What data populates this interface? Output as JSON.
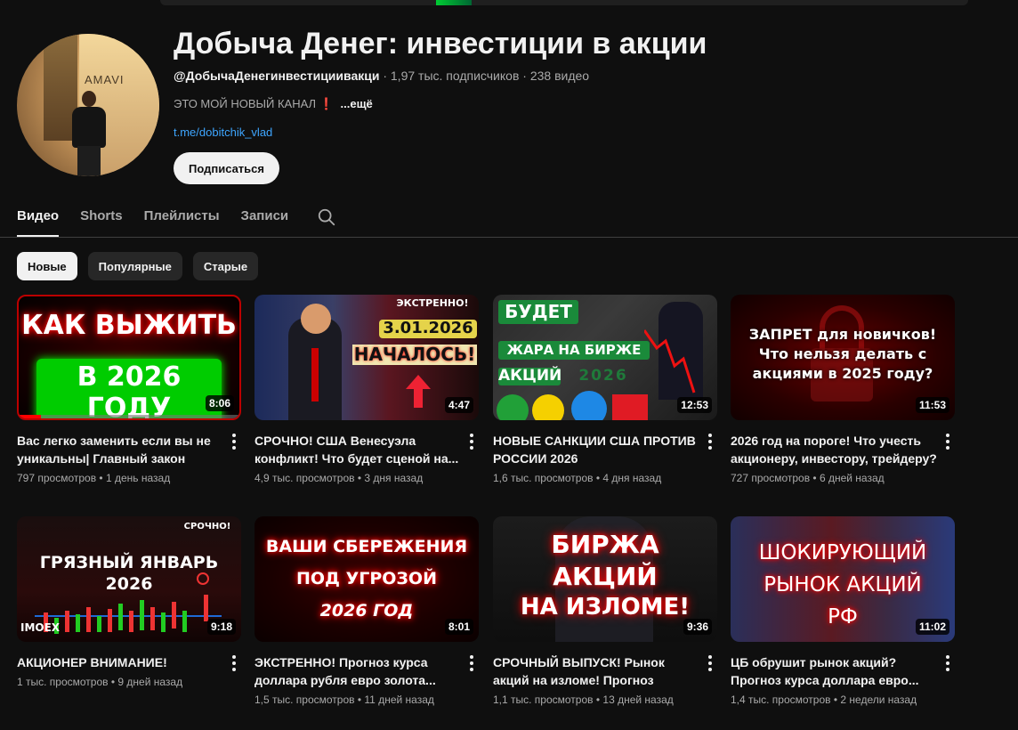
{
  "channel": {
    "title": "Добыча Денег: инвестиции в акции",
    "handle": "@ДобычаДенегинвестициивакци",
    "stats": " · 1,97 тыс. подписчиков · 238 видео",
    "description": "ЭТО МОЙ НОВЫЙ КАНАЛ",
    "description_mark": "❗",
    "more": "...ещё",
    "link": "t.me/dobitchik_vlad",
    "subscribe_label": "Подписаться",
    "avatar_sign": "AMAVI"
  },
  "tabs": [
    {
      "label": "Видео",
      "active": true
    },
    {
      "label": "Shorts",
      "active": false
    },
    {
      "label": "Плейлисты",
      "active": false
    },
    {
      "label": "Записи",
      "active": false
    }
  ],
  "chips": [
    {
      "label": "Новые",
      "active": true
    },
    {
      "label": "Популярные",
      "active": false
    },
    {
      "label": "Старые",
      "active": false
    }
  ],
  "videos": [
    {
      "title": "Вас легко заменить если вы не уникальны| Главный закон дене...",
      "meta": "797 просмотров • 1 день назад",
      "duration": "8:06",
      "watched": 0.06,
      "thumb_text": [
        "КАК ВЫЖИТЬ",
        "В 2026 ГОДУ"
      ]
    },
    {
      "title": "СРОЧНО! США Венесуэла конфликт! Что будет сценой на...",
      "meta": "4,9 тыс. просмотров • 3 дня назад",
      "duration": "4:47",
      "thumb_text": [
        "ЭКСТРЕННО!",
        "3.01.2026",
        "НАЧАЛОСЬ!"
      ]
    },
    {
      "title": "НОВЫЕ САНКЦИИ США ПРОТИВ РОССИИ 2026",
      "meta": "1,6 тыс. просмотров • 4 дня назад",
      "duration": "12:53",
      "thumb_text": [
        "БУДЕТ",
        "ЖАРА НА БИРЖЕ",
        "АКЦИЙ",
        "2026"
      ]
    },
    {
      "title": "2026 год на пороге! Что учесть акционеру, инвестору, трейдеру?",
      "meta": "727 просмотров • 6 дней назад",
      "duration": "11:53",
      "thumb_text": [
        "ЗАПРЕТ для новичков!",
        "Что нельзя делать с",
        "акциями в 2025 году?"
      ]
    },
    {
      "title": "АКЦИОНЕР ВНИМАНИЕ!",
      "meta": "1 тыс. просмотров • 9 дней назад",
      "duration": "9:18",
      "thumb_text": [
        "СРОЧНО!",
        "ГРЯЗНЫЙ ЯНВАРЬ",
        "2026",
        "IMOEX"
      ]
    },
    {
      "title": "ЭКСТРЕННО! Прогноз курса доллара рубля евро золота...",
      "meta": "1,5 тыс. просмотров • 11 дней назад",
      "duration": "8:01",
      "thumb_text": [
        "ВАШИ СБЕРЕЖЕНИЯ",
        "ПОД УГРОЗОЙ",
        "2026 ГОД"
      ]
    },
    {
      "title": "СРОЧНЫЙ ВЫПУСК! Рынок акций на изломе! Прогноз курса...",
      "meta": "1,1 тыс. просмотров • 13 дней назад",
      "duration": "9:36",
      "thumb_text": [
        "БИРЖА",
        "АКЦИЙ",
        "НА ИЗЛОМЕ!"
      ]
    },
    {
      "title": "ЦБ обрушит рынок акций? Прогноз курса доллара евро...",
      "meta": "1,4 тыс. просмотров • 2 недели назад",
      "duration": "11:02",
      "thumb_text": [
        "ШОКИРУЮЩИЙ",
        "РЫНОК АКЦИЙ",
        "РФ"
      ]
    }
  ]
}
